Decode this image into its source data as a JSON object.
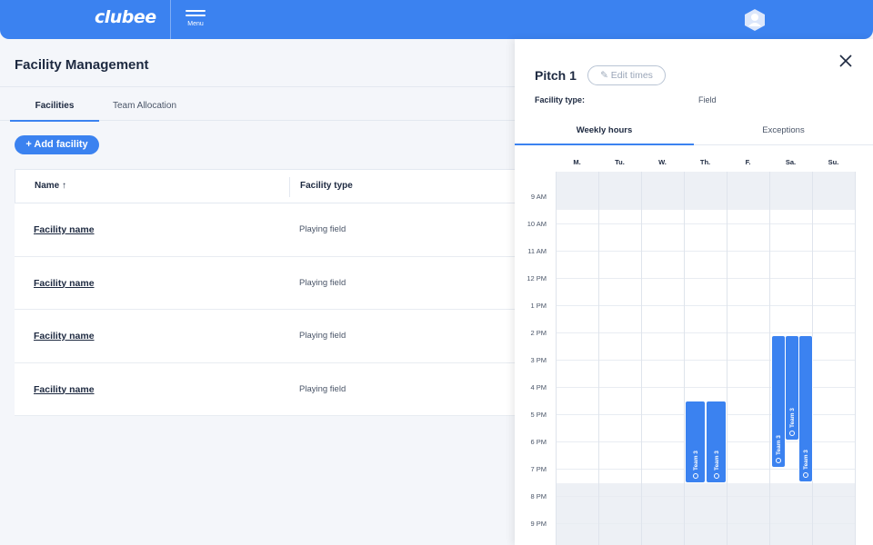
{
  "header": {
    "logo": "clubee",
    "menu_label": "Menu"
  },
  "page": {
    "title": "Facility Management",
    "tabs": [
      {
        "label": "Facilities"
      },
      {
        "label": "Team Allocation"
      }
    ],
    "add_button": "+ Add facility",
    "table": {
      "columns": [
        {
          "label": "Name ↑"
        },
        {
          "label": "Facility type"
        }
      ],
      "rows": [
        {
          "name": "Facility name",
          "type": "Playing field"
        },
        {
          "name": "Facility name",
          "type": "Playing field"
        },
        {
          "name": "Facility name",
          "type": "Playing field"
        },
        {
          "name": "Facility name",
          "type": "Playing field"
        }
      ]
    }
  },
  "panel": {
    "title": "Pitch 1",
    "edit_button": "✎ Edit times",
    "facility_type_label": "Facility type:",
    "facility_type_value": "Field",
    "tabs": [
      {
        "label": "Weekly hours"
      },
      {
        "label": "Exceptions"
      }
    ],
    "days": [
      "M.",
      "Tu.",
      "W.",
      "Th.",
      "F.",
      "Sa.",
      "Su."
    ],
    "hours": [
      "9 AM",
      "10 AM",
      "11 AM",
      "12 PM",
      "1 PM",
      "2 PM",
      "3 PM",
      "4 PM",
      "5 PM",
      "6 PM",
      "7 PM",
      "8 PM",
      "9 PM"
    ],
    "events": [
      {
        "label": "Team 3"
      },
      {
        "label": "Team 3"
      },
      {
        "label": "Team 3"
      },
      {
        "label": "Team 3"
      },
      {
        "label": "Team 3"
      }
    ]
  },
  "colors": {
    "accent": "#3b82f0",
    "closed_hours": "#edf0f5"
  }
}
